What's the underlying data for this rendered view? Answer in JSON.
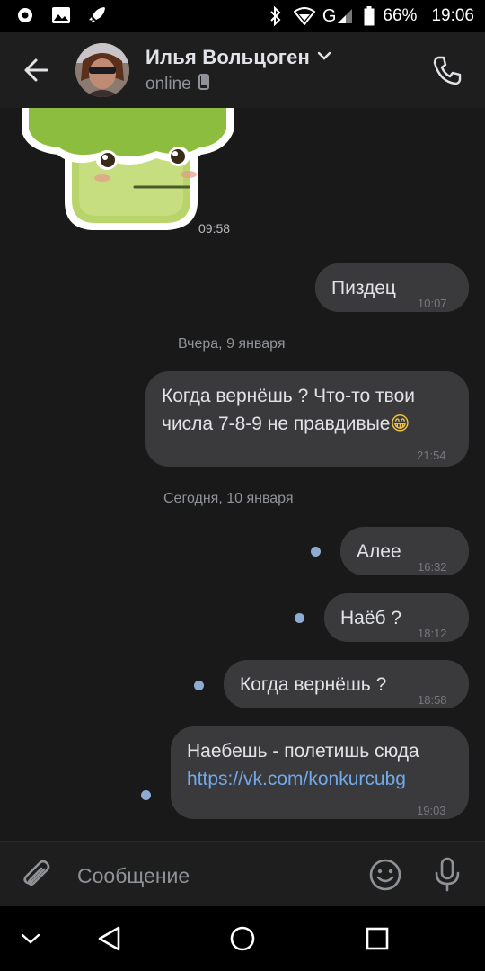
{
  "status_bar": {
    "battery": "66%",
    "time": "19:06",
    "network": "G",
    "icons": [
      "record-icon",
      "gallery-icon",
      "rocket-icon",
      "bluetooth-icon",
      "wifi-icon",
      "signal-icon",
      "battery-icon"
    ]
  },
  "header": {
    "contact_name": "Илья Вольцоген",
    "presence": "online",
    "icons": [
      "back-arrow-icon",
      "chevron-down-icon",
      "phone-device-icon",
      "call-icon"
    ]
  },
  "chat": {
    "sticker": {
      "name": "broccoli-sticker",
      "time": "09:58"
    },
    "messages": [
      {
        "text": "Пиздец",
        "time": "10:07",
        "unread": false
      },
      {
        "date_separator": "Вчера, 9 января"
      },
      {
        "text_line1": "Когда вернёшь ? Что-то твои",
        "text_line2": "числа 7-8-9 не правдивые",
        "emoji": "😁",
        "time": "21:54",
        "unread": false
      },
      {
        "date_separator": "Сегодня, 10 января"
      },
      {
        "text": "Алее",
        "time": "16:32",
        "unread": true
      },
      {
        "text": "Наёб ?",
        "time": "18:12",
        "unread": true
      },
      {
        "text": "Когда вернёшь ?",
        "time": "18:58",
        "unread": true
      },
      {
        "text_line1": "Наебешь - полетишь сюда",
        "link": "https://vk.com/konkurcubg",
        "time": "19:03",
        "unread": true
      }
    ]
  },
  "composer": {
    "placeholder": "Сообщение",
    "icons": [
      "attach-icon",
      "emoji-icon",
      "mic-icon"
    ]
  },
  "nav_bar": {
    "icons": [
      "hide-keyboard-icon",
      "back-icon",
      "home-icon",
      "recents-icon"
    ]
  },
  "colors": {
    "background": "#19191a",
    "header": "#1e1e1f",
    "bubble": "#3a3a3c",
    "link": "#71aaeb",
    "unread_dot": "#8eabd4"
  }
}
